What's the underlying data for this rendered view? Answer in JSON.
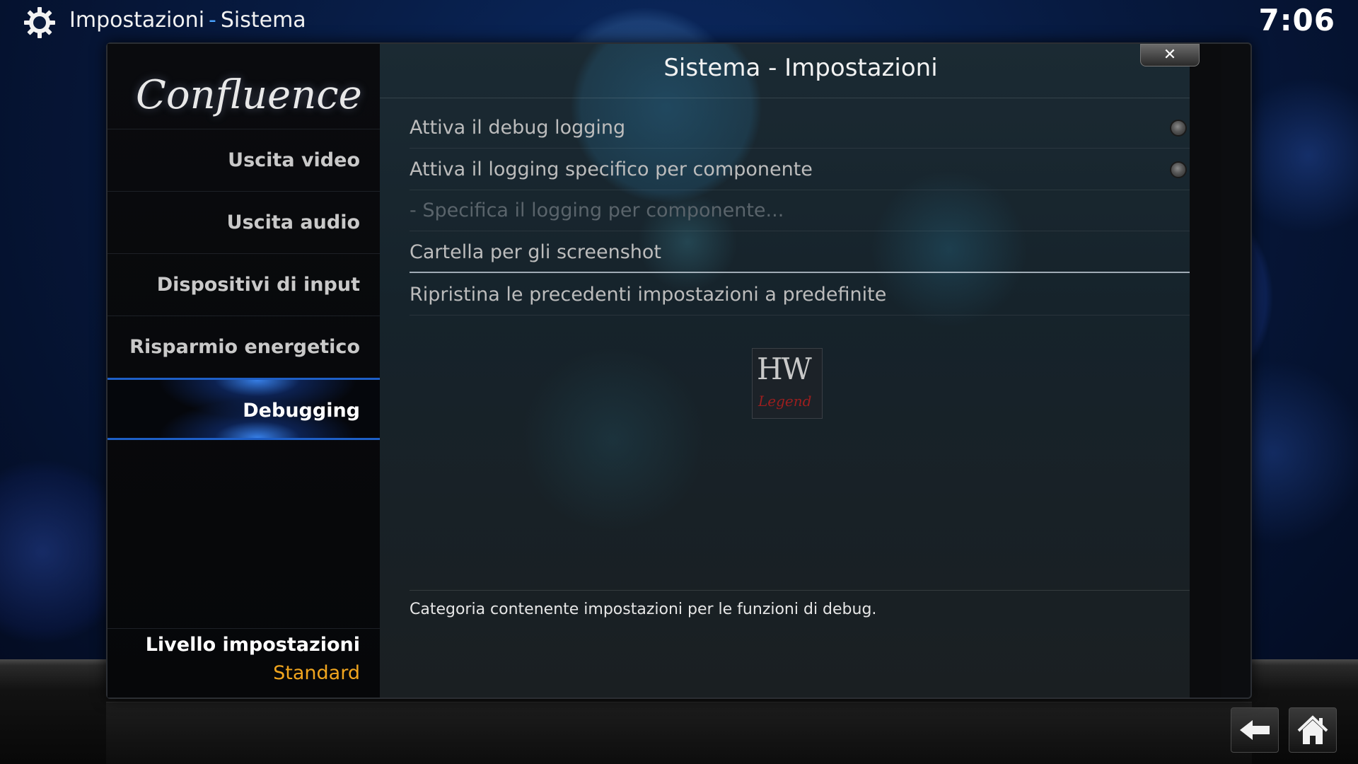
{
  "header": {
    "section": "Impostazioni",
    "separator": "-",
    "page": "Sistema",
    "clock": "7:06"
  },
  "dialog": {
    "title": "Sistema - Impostazioni",
    "close_label": "✕",
    "logo": "Confluence"
  },
  "sidebar": {
    "items": [
      {
        "label": "Uscita video",
        "active": false
      },
      {
        "label": "Uscita audio",
        "active": false
      },
      {
        "label": "Dispositivi di input",
        "active": false
      },
      {
        "label": "Risparmio energetico",
        "active": false
      },
      {
        "label": "Debugging",
        "active": true
      }
    ],
    "level_label": "Livello impostazioni",
    "level_value": "Standard"
  },
  "settings": [
    {
      "label": "Attiva il debug logging",
      "type": "toggle"
    },
    {
      "label": "Attiva il logging specifico per componente",
      "type": "toggle"
    },
    {
      "label": "- Specifica il logging per componente...",
      "type": "action",
      "disabled": true
    },
    {
      "label": "Cartella per gli screenshot",
      "type": "action",
      "focused": true
    },
    {
      "label": "Ripristina le precedenti impostazioni a predefinite",
      "type": "action"
    }
  ],
  "watermark": {
    "top": "HW",
    "bottom": "Legend"
  },
  "description": "Categoria contenente impostazioni per le funzioni di debug.",
  "colors": {
    "accent": "#1e5fc7",
    "level_value": "#f0a51e",
    "disabled_text": "#5a646b"
  },
  "icons": {
    "top_left": "gear-icon",
    "nav_back": "back-arrow-icon",
    "nav_home": "home-icon"
  }
}
